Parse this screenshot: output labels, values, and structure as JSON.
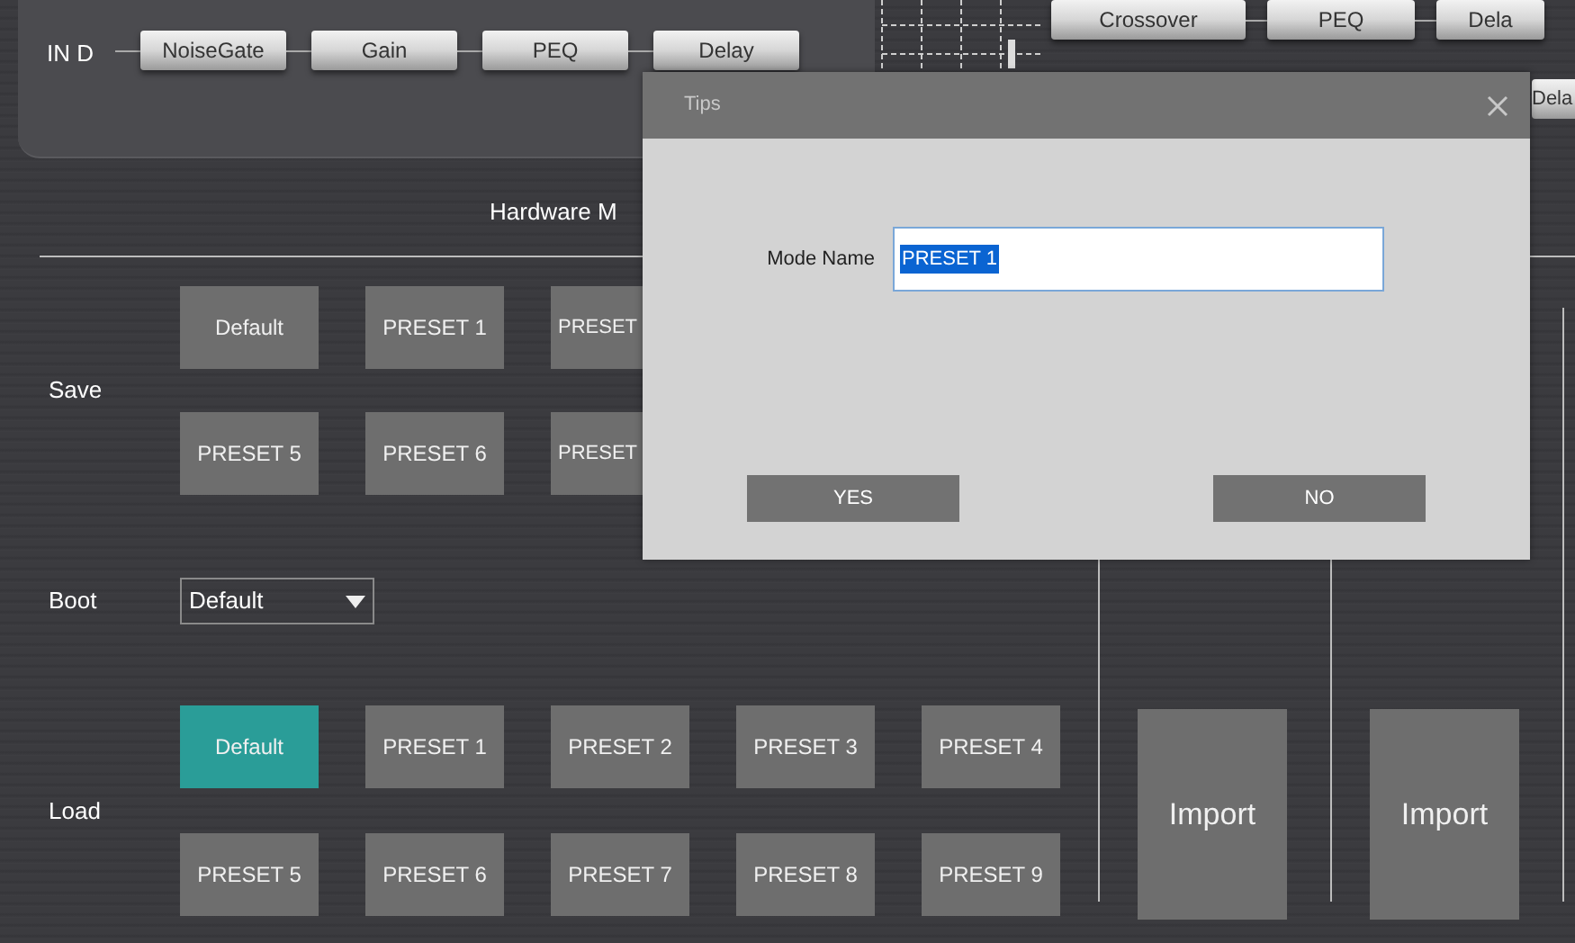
{
  "top_chain": {
    "label": "IN D",
    "modules": [
      "NoiseGate",
      "Gain",
      "PEQ",
      "Delay"
    ]
  },
  "output_modules": {
    "row_1": [
      "Crossover",
      "PEQ",
      "Dela"
    ],
    "row_2": [
      "Dela"
    ]
  },
  "section_title": "Hardware M",
  "save": {
    "label": "Save",
    "presets": [
      {
        "label": "Default",
        "partial": false
      },
      {
        "label": "PRESET 1",
        "partial": false
      },
      {
        "label": "PRESET",
        "partial": true
      },
      {
        "label": "PRESET 5",
        "partial": false
      },
      {
        "label": "PRESET 6",
        "partial": false
      },
      {
        "label": "PRESET",
        "partial": true
      }
    ]
  },
  "boot": {
    "label": "Boot",
    "value": "Default"
  },
  "load": {
    "label": "Load",
    "presets": [
      {
        "label": "Default",
        "selected": true
      },
      {
        "label": "PRESET 1",
        "selected": false
      },
      {
        "label": "PRESET 2",
        "selected": false
      },
      {
        "label": "PRESET 3",
        "selected": false
      },
      {
        "label": "PRESET 4",
        "selected": false
      },
      {
        "label": "PRESET 5",
        "selected": false
      },
      {
        "label": "PRESET 6",
        "selected": false
      },
      {
        "label": "PRESET 7",
        "selected": false
      },
      {
        "label": "PRESET 8",
        "selected": false
      },
      {
        "label": "PRESET 9",
        "selected": false
      }
    ]
  },
  "import_buttons": [
    "Import",
    "Import"
  ],
  "dialog": {
    "title": "Tips",
    "field_label": "Mode Name",
    "field_value": "PRESET 1",
    "buttons": [
      "YES",
      "NO"
    ]
  }
}
